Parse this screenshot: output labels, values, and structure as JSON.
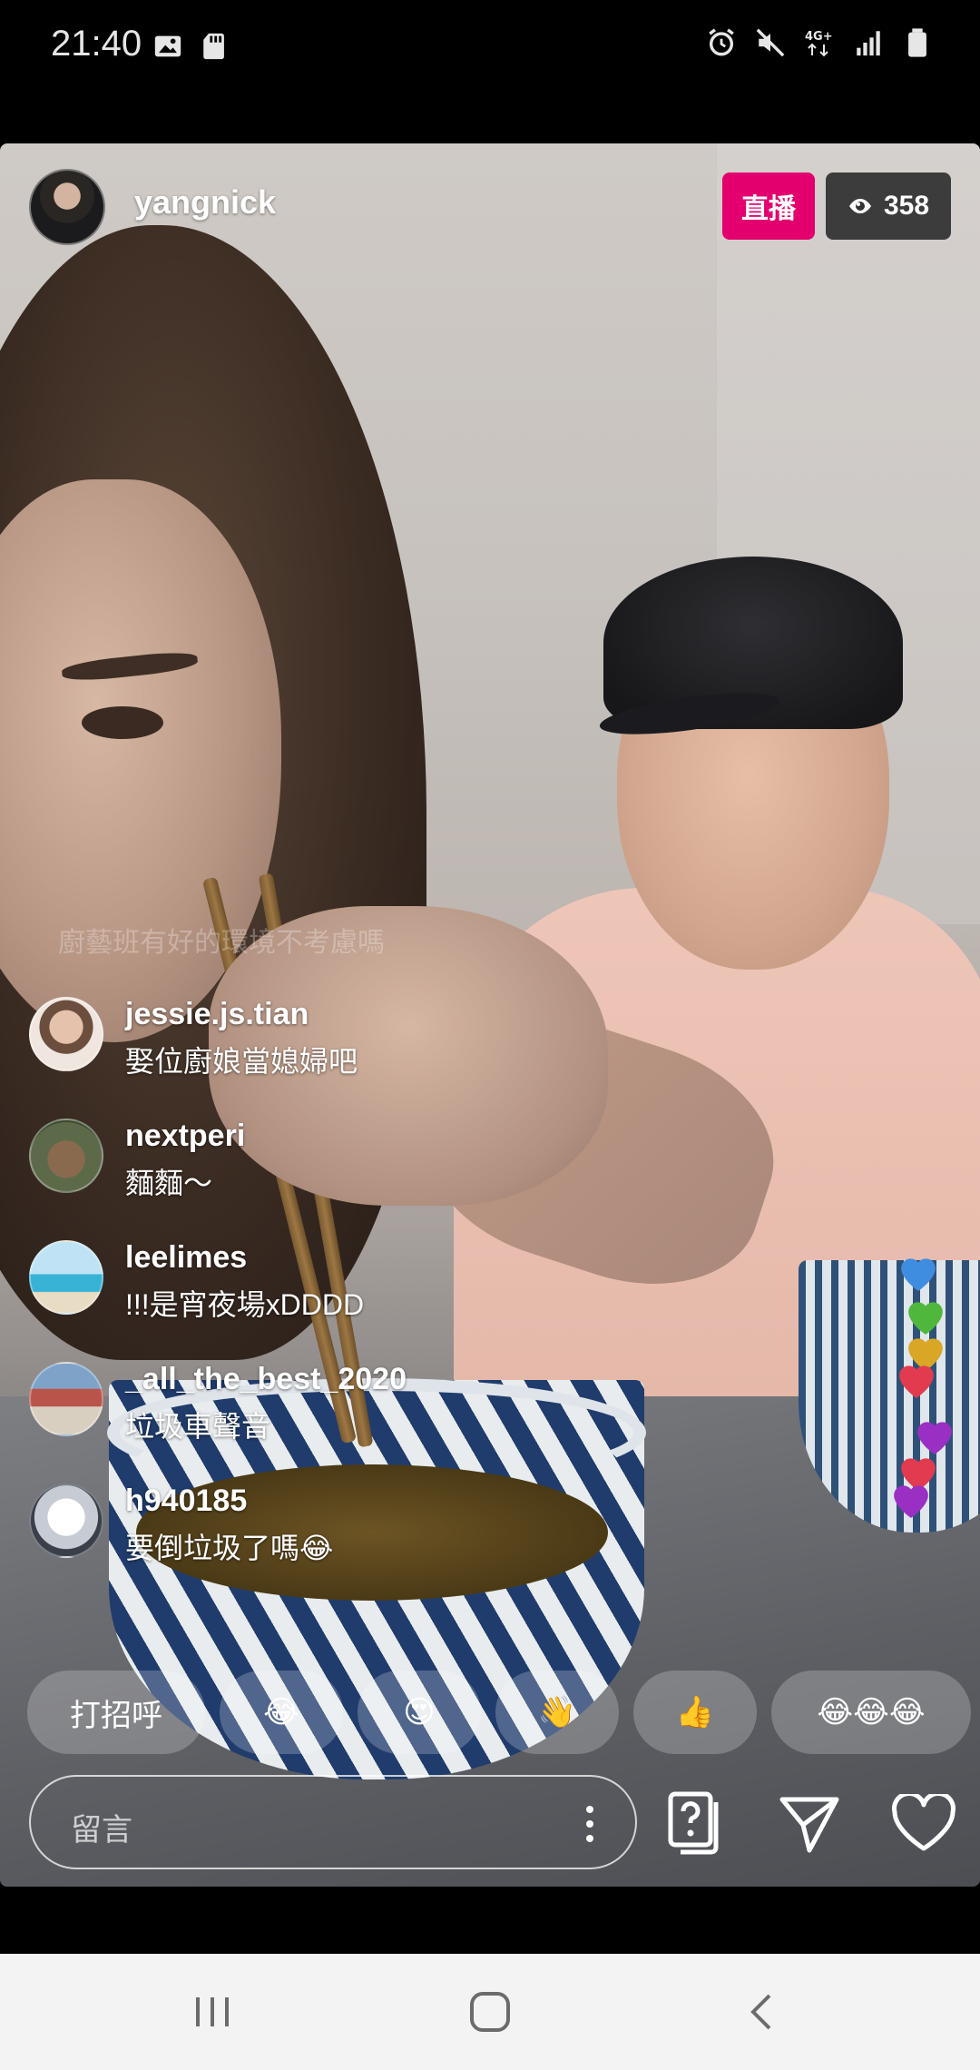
{
  "status_bar": {
    "time": "21:40",
    "left_icons": [
      "image-icon",
      "sd-card-icon"
    ],
    "right_icons": [
      "alarm-icon",
      "mute-icon",
      "4g-plus-icon",
      "signal-icon",
      "battery-icon"
    ],
    "network_label": "4G+"
  },
  "live": {
    "host_username": "yangnick",
    "live_label": "直播",
    "viewer_count": "358"
  },
  "faded_comment": "廚藝班有好的環境不考慮嗎",
  "comments": [
    {
      "user": "jessie.js.tian",
      "text": "娶位廚娘當媳婦吧"
    },
    {
      "user": "nextperi",
      "text": "麵麵～"
    },
    {
      "user": "leelimes",
      "text": "!!!是宵夜場xDDDD"
    },
    {
      "user": "_all_the_best_2020",
      "text": "垃圾車聲音"
    },
    {
      "user": "h940185",
      "text": "要倒垃圾了嗎😂"
    }
  ],
  "quick_reactions": [
    "打招呼",
    "😂",
    "😍",
    "👋",
    "👍",
    "😂😂😂"
  ],
  "input": {
    "placeholder": "留言"
  },
  "colors": {
    "live_badge": "#e3006e",
    "viewer_badge": "#282828",
    "nav_bar": "#f3f3f3"
  },
  "floating_hearts": [
    "blue",
    "green",
    "yellow",
    "red",
    "purple",
    "red",
    "purple"
  ]
}
